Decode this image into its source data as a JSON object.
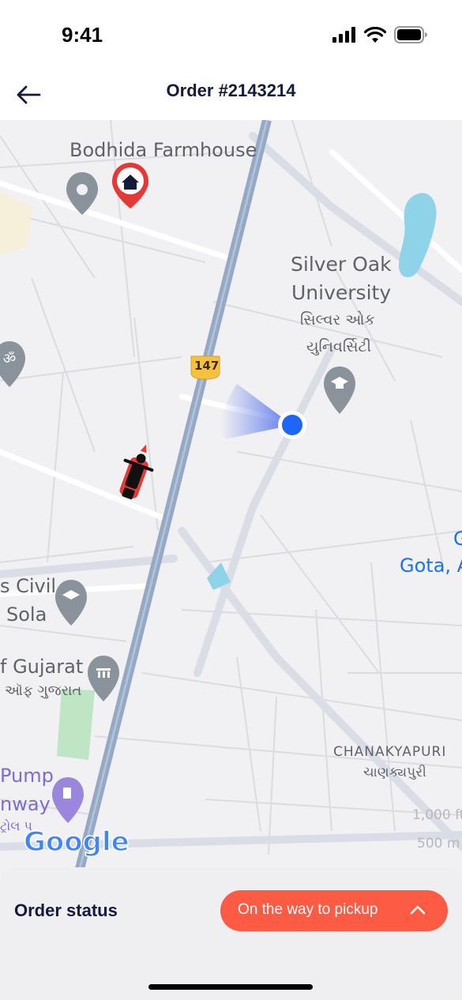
{
  "status_bar": {
    "time": "9:41"
  },
  "header": {
    "title": "Order #2143214"
  },
  "map": {
    "labels": {
      "bodhida": "Bodhida Farmhouse",
      "silver_oak_1": "Silver Oak",
      "silver_oak_2": "University",
      "silver_oak_guj_1": "સિલ્વર ઓક",
      "silver_oak_guj_2": "યુનિવર્સિટી",
      "highway": "147",
      "civil": "s Civil",
      "sola": "Sola",
      "gujarat": "f Gujarat",
      "gujarat_guj": "ઑફ ગુજરાત",
      "gota": "Gota, A",
      "gota_g": "G",
      "chanakyapuri": "CHANAKYAPURI",
      "chanakyapuri_guj": "ચાણક્યપુરી",
      "pump": "Pump",
      "nway": "nway",
      "nway_guj": "ટ્રોલ પ",
      "scale_1": "1,000 ft",
      "scale_2": "500 m",
      "google": "Google"
    }
  },
  "sheet": {
    "label": "Order status",
    "status_button": "On the way to pickup"
  },
  "colors": {
    "accent": "#fd5b44",
    "title": "#141b3a",
    "location_dot": "#1e66f5"
  }
}
